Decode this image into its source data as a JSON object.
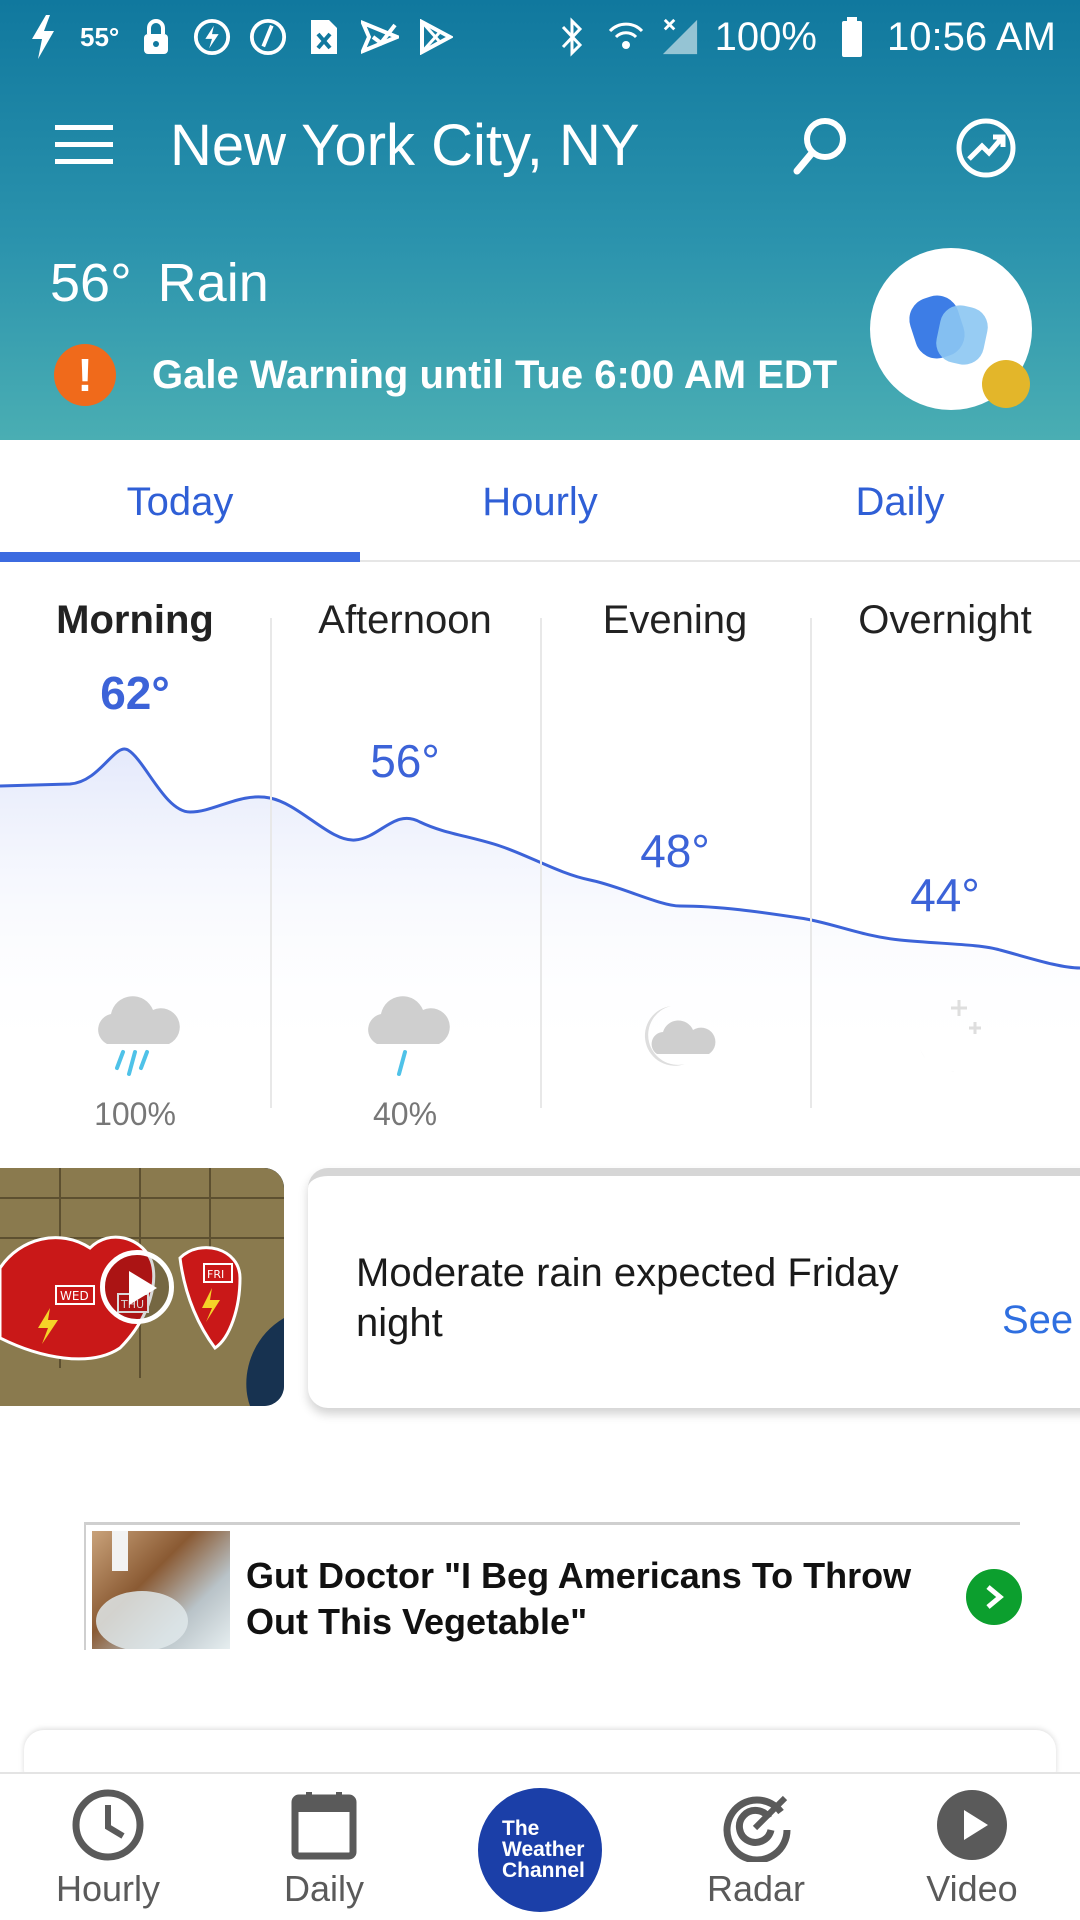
{
  "status_bar": {
    "temp": "55°",
    "battery": "100%",
    "time": "10:56 AM"
  },
  "header": {
    "location": "New York City, NY",
    "current_temp": "56°",
    "current_condition": "Rain",
    "alert_text": "Gale Warning until Tue 6:00 AM EDT"
  },
  "tabs": [
    {
      "label": "Today",
      "active": true
    },
    {
      "label": "Hourly",
      "active": false
    },
    {
      "label": "Daily",
      "active": false
    }
  ],
  "dayparts": [
    {
      "label": "Morning",
      "temp": "62°",
      "icon": "rain-cloud-icon",
      "precip": "100%"
    },
    {
      "label": "Afternoon",
      "temp": "56°",
      "icon": "rain-cloud-icon",
      "precip": "40%"
    },
    {
      "label": "Evening",
      "temp": "48°",
      "icon": "partly-cloudy-night-icon",
      "precip": ""
    },
    {
      "label": "Overnight",
      "temp": "44°",
      "icon": "clear-night-icon",
      "precip": ""
    }
  ],
  "temperature_trend": [
    62,
    56,
    48,
    44
  ],
  "insight": {
    "text": "Moderate rain expected Friday night",
    "link": "See"
  },
  "video_thumb": {
    "labels": [
      "WED",
      "THU",
      "FRI"
    ]
  },
  "ad": {
    "title": "Gut Doctor \"I Beg Americans To Throw Out This Vegetable\""
  },
  "bottom_nav": {
    "hourly": "Hourly",
    "daily": "Daily",
    "logo_line1": "The",
    "logo_line2": "Weather",
    "logo_line3": "Channel",
    "radar": "Radar",
    "video": "Video"
  },
  "colors": {
    "header_top": "#10789e",
    "header_bottom": "#4aaeb3",
    "accent_blue": "#3c63d8",
    "alert_orange": "#f06a1b",
    "logo_blue": "#1b3fa8",
    "ad_green": "#0c9f2e"
  }
}
